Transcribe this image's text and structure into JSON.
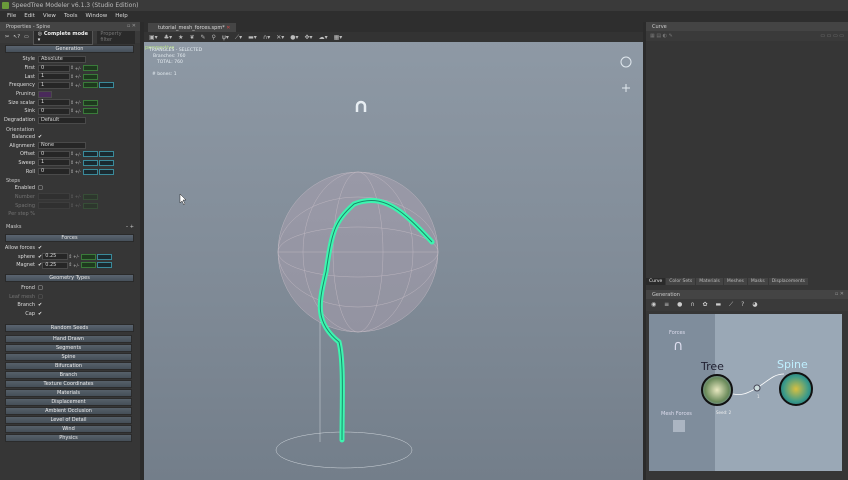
{
  "app": {
    "title": "SpeedTree Modeler v6.1.3 (Studio Edition)"
  },
  "menu": [
    "File",
    "Edit",
    "View",
    "Tools",
    "Window",
    "Help"
  ],
  "properties": {
    "title": "Properties - Spine",
    "mode": "Complete mode",
    "filter_placeholder": "Property filter",
    "generation_header": "Generation",
    "gen_rows": [
      {
        "label": "Style",
        "value": "Absolute",
        "type": "select"
      },
      {
        "label": "First",
        "value": "0"
      },
      {
        "label": "Last",
        "value": "1"
      },
      {
        "label": "Frequency",
        "value": "1",
        "extra": true
      },
      {
        "label": "Pruning",
        "value": "",
        "type": "pruning"
      },
      {
        "label": "Size scalar",
        "value": "1"
      },
      {
        "label": "Sink",
        "value": "0"
      },
      {
        "label": "Degradation",
        "value": "Default",
        "type": "select"
      }
    ],
    "orientation": {
      "title": "Orientation",
      "balanced_label": "Balanced",
      "alignment_label": "Alignment",
      "alignment": "None",
      "rows": [
        {
          "label": "Offset",
          "value": "0"
        },
        {
          "label": "Sweep",
          "value": "1"
        },
        {
          "label": "Roll",
          "value": "0"
        }
      ]
    },
    "steps": {
      "title": "Steps",
      "enabled_label": "Enabled",
      "rows": [
        {
          "label": "Number",
          "value": ""
        },
        {
          "label": "Spacing",
          "value": ""
        }
      ],
      "last": "Per step %"
    },
    "masks": "Masks",
    "forces": {
      "header": "Forces",
      "allow_label": "Allow forces",
      "rows": [
        {
          "label": "sphere",
          "value": "0.25"
        },
        {
          "label": "Magnet",
          "value": "0.25"
        }
      ]
    },
    "geometry": {
      "header": "Geometry Types",
      "items": [
        "Frond",
        "Leaf mesh",
        "Branch",
        "Cap"
      ],
      "checked": [
        false,
        false,
        true,
        true
      ]
    },
    "random_seeds": "Random Seeds",
    "sections": [
      "Hand Drawn",
      "Segments",
      "Spine",
      "Bifurcation",
      "Branch",
      "Texture Coordinates",
      "Materials",
      "Displacement",
      "Ambient Occlusion",
      "Level of Detail",
      "Wind",
      "Physics"
    ]
  },
  "viewport": {
    "tab": "tutorial_mesh_forces.spm*",
    "camera": "perspective",
    "hud": [
      "TRIANGLES - SELECTED",
      "Branches: 760",
      "TOTAL: 760",
      "",
      "# bones: 1"
    ]
  },
  "curve": {
    "title": "Curve",
    "tabs": [
      "Curve",
      "Color Sets",
      "Materials",
      "Meshes",
      "Masks",
      "Displacements"
    ]
  },
  "generation_panel": {
    "title": "Generation",
    "nodes": {
      "forces": "Forces",
      "mesh_forces": "Mesh Forces",
      "tree": "Tree",
      "spine": "Spine",
      "seed": "Seed: 2",
      "link": "1"
    }
  },
  "colors": {
    "accent_green": "#3df5b0",
    "spine_label": "#bfefff"
  }
}
